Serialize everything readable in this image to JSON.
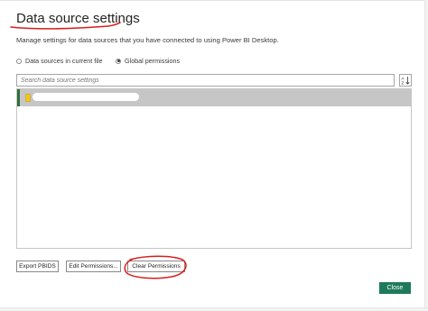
{
  "dialog": {
    "title": "Data source settings",
    "subtitle": "Manage settings for data sources that you have connected to using Power BI Desktop."
  },
  "scope": {
    "options": [
      {
        "label": "Data sources in current file",
        "selected": false
      },
      {
        "label": "Global permissions",
        "selected": true
      }
    ]
  },
  "search": {
    "placeholder": "Search data source settings",
    "sort_icon": "sort-az-icon"
  },
  "list": {
    "items": [
      {
        "label": "",
        "redacted": true,
        "selected": true,
        "icon": "data-source-icon"
      }
    ]
  },
  "actions": {
    "export_label": "Export PBIDS",
    "edit_label": "Edit Permissions...",
    "clear_label": "Clear Permissions"
  },
  "footer": {
    "close_label": "Close"
  },
  "colors": {
    "annotation": "#d81e1e",
    "close_button": "#1f7a5a",
    "selected_row": "#c6c6c6",
    "row_indicator": "#2f6f3b"
  }
}
